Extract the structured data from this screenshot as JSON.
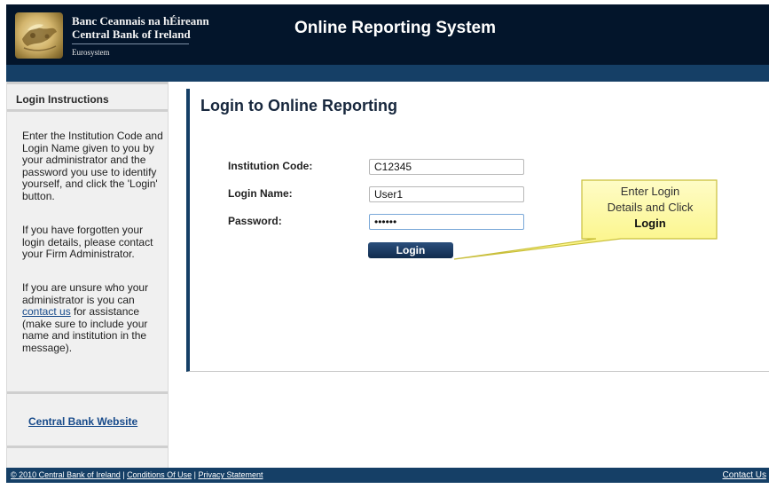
{
  "header": {
    "bank_name_irish": "Banc Ceannais na hÉireann",
    "bank_name_english": "Central Bank of Ireland",
    "eurosystem": "Eurosystem",
    "app_title": "Online Reporting System"
  },
  "sidebar": {
    "heading": "Login Instructions",
    "para1": "Enter the Institution Code and Login Name given to you by your administrator and the password you use to identify yourself, and click the 'Login' button.",
    "para2": "If you have forgotten your login details, please contact your Firm Administrator.",
    "para3_before": "If you are unsure who your administrator is you can ",
    "para3_link": "contact us",
    "para3_after": " for assistance (make sure to include your name and institution in the message).",
    "website_link": "Central Bank Website"
  },
  "main": {
    "title": "Login to Online Reporting",
    "institution_label": "Institution Code:",
    "institution_value": "C12345",
    "login_label": "Login Name:",
    "login_value": "User1",
    "password_label": "Password:",
    "password_value": "••••••",
    "login_button": "Login"
  },
  "callout": {
    "line1": "Enter Login",
    "line2": "Details and Click",
    "line3": "Login",
    "fill_color": "#fdf79a"
  },
  "footer": {
    "copyright": "© 2010 Central Bank of Ireland",
    "sep1": " | ",
    "conditions": "Conditions Of Use",
    "sep2": " | ",
    "privacy": "Privacy Statement",
    "contact": "Contact Us"
  },
  "colors": {
    "header_bg": "#03152b",
    "nav_bg": "#153f66",
    "sidebar_bg": "#f0f0f0",
    "link": "#174a8a"
  }
}
